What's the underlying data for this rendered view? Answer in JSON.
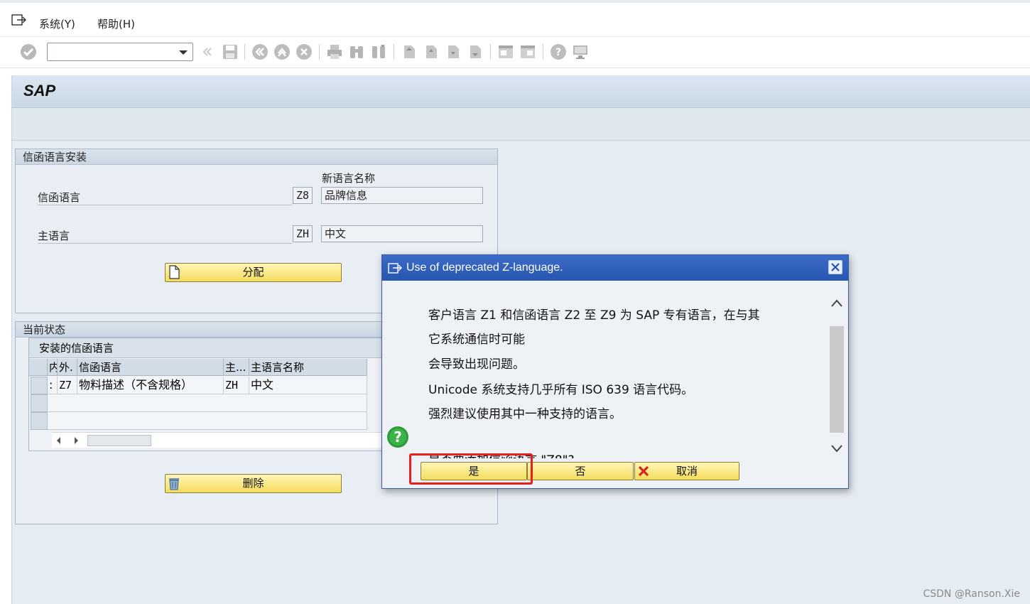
{
  "menubar": {
    "items": [
      "系统(Y)",
      "帮助(H)"
    ]
  },
  "header": {
    "title": "SAP"
  },
  "install_group": {
    "title": "信函语言安装",
    "new_lang_header": "新语言名称",
    "letter_lang_label": "信函语言",
    "letter_lang_code": "Z8",
    "letter_lang_name": "品牌信息",
    "main_lang_label": "主语言",
    "main_lang_code": "ZH",
    "main_lang_name": "中文",
    "assign_button": "分配"
  },
  "status_group": {
    "title": "当前状态",
    "table_title": "安装的信函语言",
    "columns": [
      "内",
      "外.",
      "信函语言",
      "主...",
      "主语言名称"
    ],
    "rows": [
      [
        ":",
        "Z7",
        "物料描述（不含规格）",
        "ZH",
        "中文"
      ]
    ],
    "delete_button": "删除"
  },
  "dialog": {
    "title": "Use of deprecated Z-language.",
    "lines": [
      "客户语言  Z1  和信函语言  Z2  至  Z9  为  SAP  专有语言，在与其",
      "它系统通信时可能",
      "会导致出现问题。",
      "Unicode  系统支持几乎所有  ISO 639  语言代码。",
      "强烈建议使用其中一种支持的语言。"
    ],
    "question": "是否要添加信函语言 \"Z8\"?",
    "yes_button": "是",
    "no_button": "否",
    "cancel_button": "取消"
  },
  "watermark": "CSDN @Ranson.Xie",
  "colors": {
    "dialog_title": "#2756b0",
    "button_yellow": "#f4dc5c",
    "highlight_red": "#e8201c"
  }
}
